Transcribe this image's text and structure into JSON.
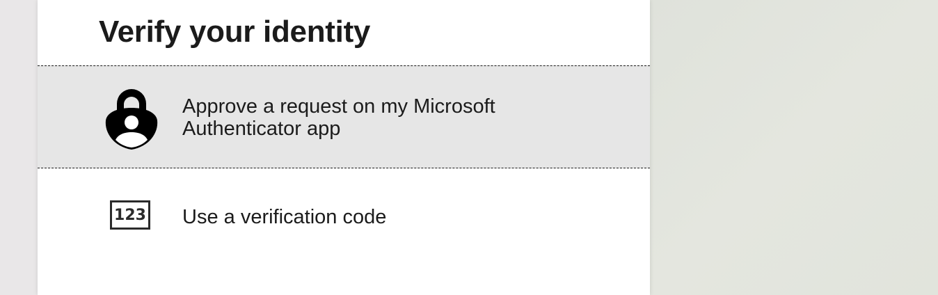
{
  "page": {
    "title": "Verify your identity"
  },
  "options": [
    {
      "label": "Approve a request on my Microsoft Authenticator app",
      "icon": "authenticator-lock-icon",
      "selected": true
    },
    {
      "label": "Use a verification code",
      "icon": "verification-code-icon",
      "icon_text": "123",
      "selected": false
    }
  ],
  "colors": {
    "card_background": "#ffffff",
    "selected_background": "#e6e6e6",
    "text": "#1b1b1b",
    "page_background": "#e6e6e4"
  }
}
